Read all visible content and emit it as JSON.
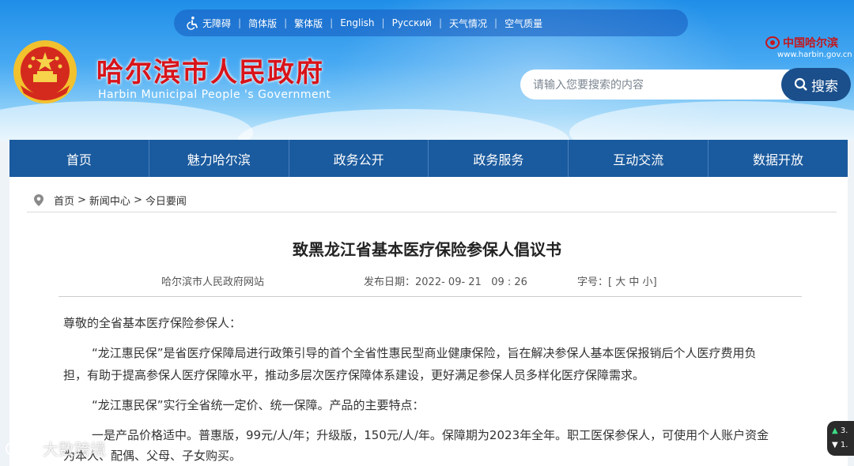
{
  "topbar": {
    "items": [
      "无障碍",
      "简体版",
      "繁体版",
      "English",
      "Русский",
      "天气情况",
      "空气质量"
    ]
  },
  "header": {
    "title": "哈尔滨市人民政府",
    "subtitle": "Harbin Municipal People 's Government",
    "brand": "中国哈尔滨",
    "brand_url": "www.harbin.gov.cn"
  },
  "search": {
    "placeholder": "请输入您要搜索的内容",
    "button_label": "搜索"
  },
  "nav": {
    "items": [
      "首页",
      "魅力哈尔滨",
      "政务公开",
      "政务服务",
      "互动交流",
      "数据开放"
    ]
  },
  "breadcrumb": {
    "items": [
      "首页",
      "新闻中心",
      "今日要闻"
    ],
    "separator": ">"
  },
  "article": {
    "title": "致黑龙江省基本医疗保险参保人倡议书",
    "source": "哈尔滨市人民政府网站",
    "date_label": "发布日期：",
    "date_value": "2022- 09- 21   09 : 26",
    "font_label": "字号：",
    "font_open": "[",
    "font_large": "大",
    "font_medium": "中",
    "font_small": "小",
    "font_close": "]",
    "greeting": "尊敬的全省基本医疗保险参保人：",
    "para1_line1": "“龙江惠民保”是省医疗保障局进行政策引导的首个全省性惠民型商业健康保险，旨在解决参保人基本医保报销后个人医疗费用负",
    "para1_line2": "担，有助于提高参保人医疗保障水平，推动多层次医疗保障体系建设，更好满足参保人员多样化医疗保障需求。",
    "para2": "“龙江惠民保”实行全省统一定价、统一保障。产品的主要特点：",
    "para3_line1": "一是产品价格适中。普惠版，99元/人/年；升级版，150元/人/年。保障期为2023年全年。职工医保参保人，可使用个人账户资金",
    "para3_line2": "为本人、配偶、父母、子女购买。"
  },
  "watermark": {
    "text": "大数跨境"
  },
  "widget": {
    "line1": "3.",
    "line2": "1."
  },
  "colors": {
    "nav_bg": "#1a5a9e",
    "title_red": "#d8141a",
    "search_btn": "#1a4f8c"
  }
}
